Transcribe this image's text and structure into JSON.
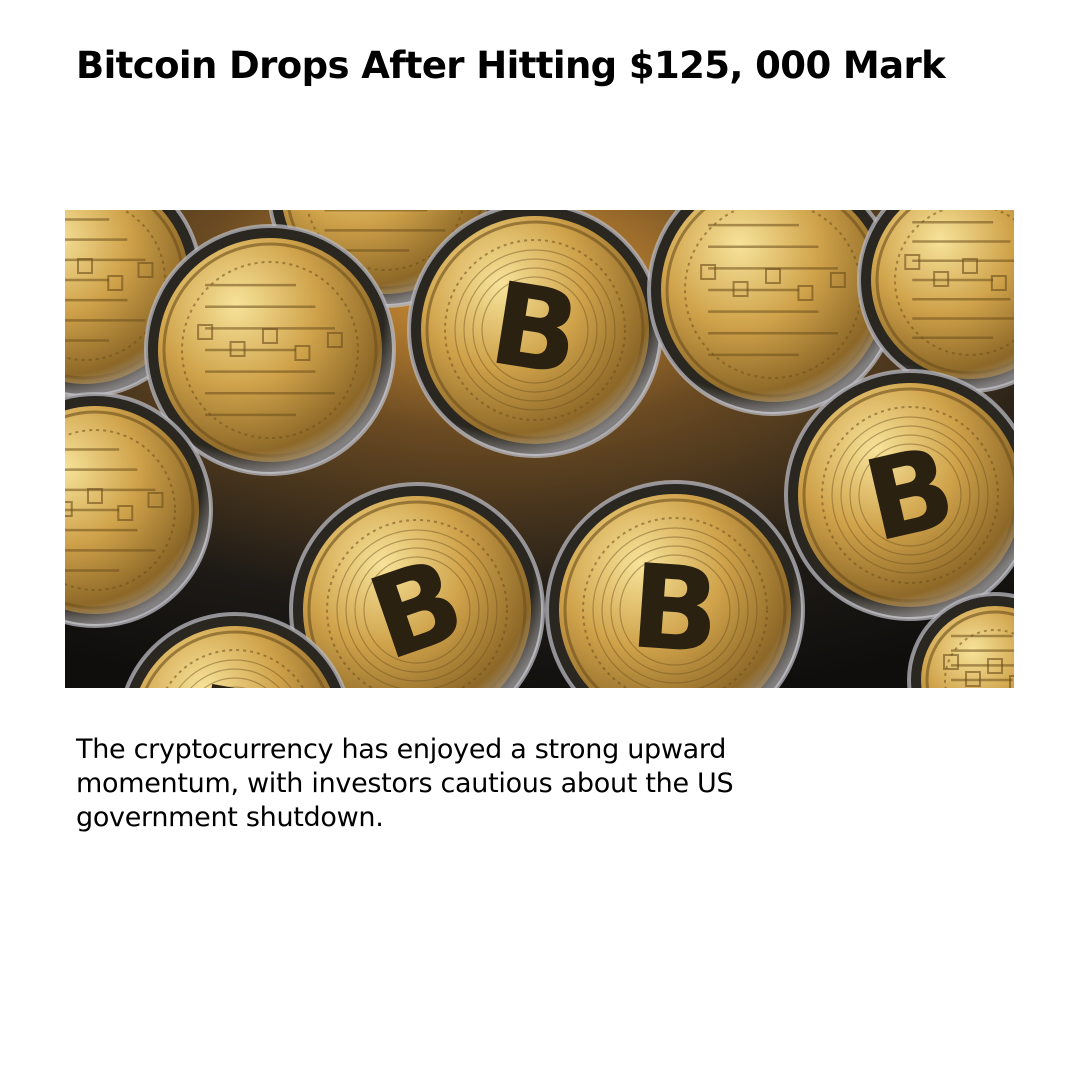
{
  "article": {
    "headline": "Bitcoin Drops After Hitting $125, 000 Mark",
    "summary": "The cryptocurrency has enjoyed a strong upward momentum, with investors cautious about the US government shutdown."
  },
  "image": {
    "icon": "bitcoin-coins-photo",
    "coin_symbol": "B",
    "colors": {
      "gold_light": "#f3d98a",
      "gold": "#c99a3f",
      "gold_dark": "#6d4f1c",
      "background": "#1a1712",
      "warm_glow": "#d8902e"
    }
  }
}
